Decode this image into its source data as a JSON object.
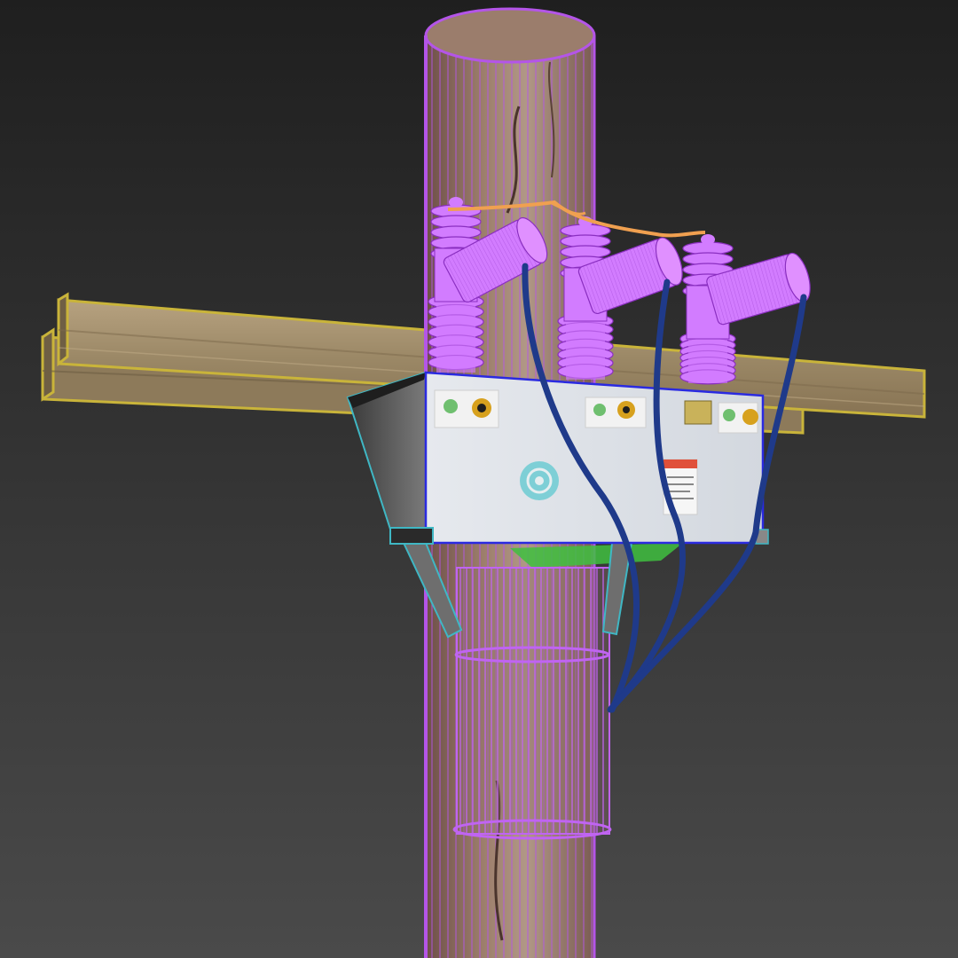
{
  "scene": {
    "description_name": "3d-viewport",
    "background_top": "#1f1f1f",
    "background_bottom": "#4a4a4a",
    "colors": {
      "wire_pole": "#b455e8",
      "wire_pole_light": "#d27cff",
      "wire_crossarm": "#c9b43a",
      "wood_light": "#b49678",
      "wood_dark": "#8a6a52",
      "crossarm_wood": "#a8956f",
      "box_face": "#dfe3ea",
      "box_outline": "#2a2ae0",
      "bracket_outline": "#3fb7c4",
      "bracket_fill": "#6e6e6e",
      "cable": "#1f3a8a",
      "jumper": "#f0a050",
      "mount_green": "#3fbf3f"
    },
    "objects": [
      "utility-pole",
      "crossarm-upper",
      "crossarm-lower",
      "recloser-box",
      "bushing-left",
      "bushing-center",
      "bushing-right",
      "cable-left",
      "cable-center",
      "cable-right",
      "jumper-wire",
      "control-cabinet-wrap",
      "support-bracket-left",
      "support-bracket-right"
    ]
  }
}
